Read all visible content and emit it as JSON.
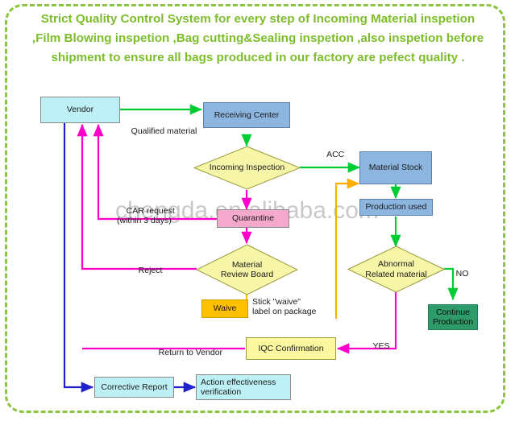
{
  "title": "Strict Quality Control System for every step of Incoming Material inspetion ,Film Blowing inspetion ,Bag cutting&Sealing inspetion ,also inspetion before shipment to ensure all bags produced in our factory are pefect quality .",
  "watermark": "chengda.en.alibaba.com",
  "colors": {
    "frame_border": "#8cc63f",
    "title_text": "#7dbd2c",
    "vendor_fill": "#bdf0f5",
    "receiving_fill": "#8cb6e0",
    "inspection_fill": "#f7f6a8",
    "quarantine_fill": "#f4a9cc",
    "waive_fill": "#ffc000",
    "iqc_fill": "#fbf8a0",
    "continue_fill": "#2e9b6b",
    "arrow_green": "#00cc33",
    "arrow_magenta": "#ff00cc",
    "arrow_blue": "#2222cc",
    "arrow_orange": "#ffae00"
  },
  "nodes": {
    "vendor": "Vendor",
    "receiving_center": "Receiving Center",
    "incoming_inspection": "Incoming Inspection",
    "material_stock": "Material Stock",
    "production_used": "Production used",
    "quarantine": "Quarantine",
    "material_review_board": "Material\nReview Board",
    "abnormal_related_material": "Abnormal\nRelated material",
    "waive": "Waive",
    "stick_waive_label": "Stick \"waive\"\nlabel on package",
    "continue_production": "Continue\nProduction",
    "iqc_confirmation": "IQC Confirmation",
    "corrective_report": "Corrective Report",
    "action_effectiveness": "Action effectiveness\nverification"
  },
  "edge_labels": {
    "qualified_material": "Qualified material",
    "acc": "ACC",
    "car_request": "CAR request\n(within 3 days)",
    "reject": "Reject",
    "no": "NO",
    "yes": "YES",
    "return_to_vendor": "Return to Vendor"
  }
}
